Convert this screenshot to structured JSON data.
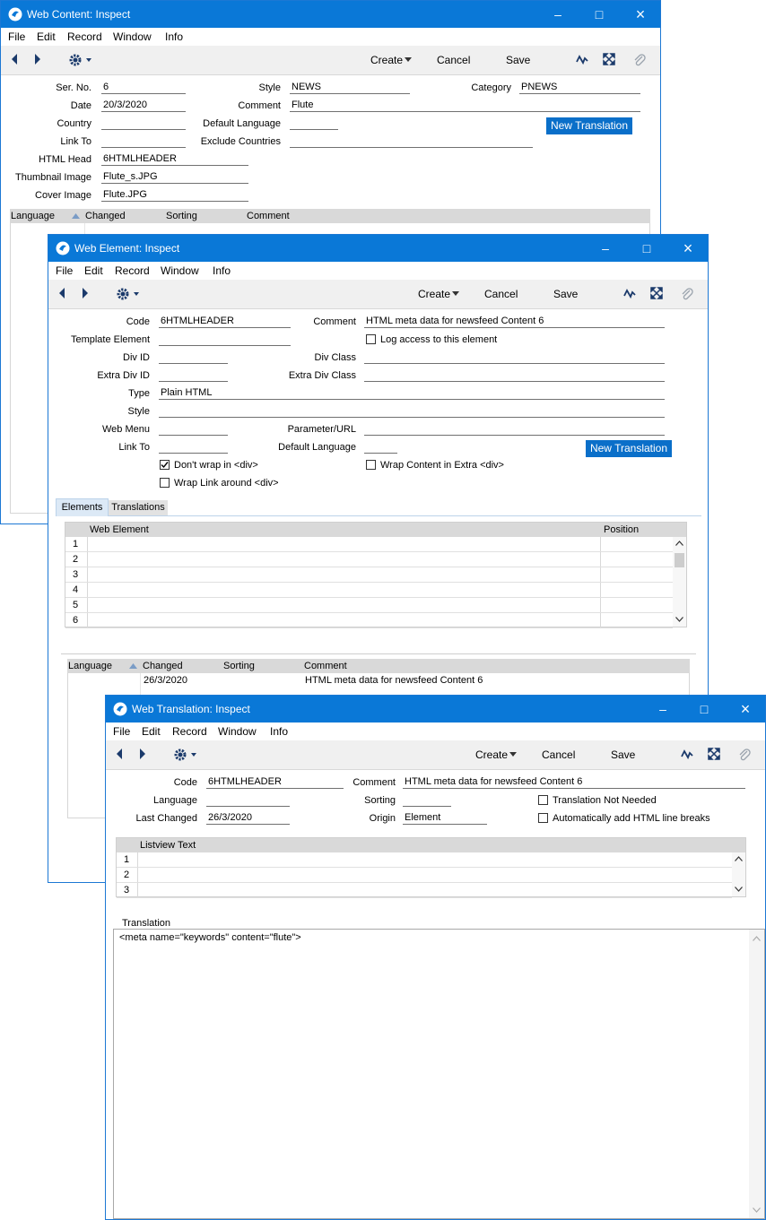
{
  "menu": {
    "file": "File",
    "edit": "Edit",
    "record": "Record",
    "window": "Window",
    "info": "Info"
  },
  "toolbar": {
    "create": "Create",
    "cancel": "Cancel",
    "save": "Save"
  },
  "web_content": {
    "title": "Web Content: Inspect",
    "labels": {
      "ser_no": "Ser. No.",
      "date": "Date",
      "country": "Country",
      "link_to": "Link To",
      "html_head": "HTML Head",
      "thumbnail": "Thumbnail Image",
      "cover": "Cover Image",
      "style": "Style",
      "comment": "Comment",
      "default_language": "Default Language",
      "exclude_countries": "Exclude Countries",
      "category": "Category"
    },
    "values": {
      "ser_no": "6",
      "date": "20/3/2020",
      "country": "",
      "link_to": "",
      "html_head": "6HTMLHEADER",
      "thumbnail": "Flute_s.JPG",
      "cover": "Flute.JPG",
      "style": "NEWS",
      "comment": "Flute",
      "default_language": "",
      "exclude_countries": "",
      "category": "PNEWS"
    },
    "new_translation": "New Translation",
    "list_headers": {
      "language": "Language",
      "changed": "Changed",
      "sorting": "Sorting",
      "comment": "Comment"
    }
  },
  "web_element": {
    "title": "Web Element: Inspect",
    "labels": {
      "code": "Code",
      "template_element": "Template Element",
      "div_id": "Div ID",
      "extra_div_id": "Extra Div ID",
      "type": "Type",
      "style": "Style",
      "web_menu": "Web Menu",
      "link_to": "Link To",
      "comment": "Comment",
      "div_class": "Div Class",
      "extra_div_class": "Extra Div Class",
      "parameter_url": "Parameter/URL",
      "default_language": "Default Language"
    },
    "values": {
      "code": "6HTMLHEADER",
      "template_element": "",
      "div_id": "",
      "extra_div_id": "",
      "type": "Plain HTML",
      "style": "",
      "web_menu": "",
      "link_to": "",
      "comment": "HTML meta data for newsfeed Content 6",
      "div_class": "",
      "extra_div_class": "",
      "parameter_url": "",
      "default_language": ""
    },
    "checkboxes": {
      "log_access": "Log access to this element",
      "dont_wrap": "Don't wrap in <div>",
      "wrap_link": "Wrap Link around <div>",
      "wrap_content": "Wrap Content in Extra <div>"
    },
    "check_states": {
      "log_access": false,
      "dont_wrap": true,
      "wrap_link": false,
      "wrap_content": false
    },
    "new_translation": "New Translation",
    "tabs": {
      "elements": "Elements",
      "translations": "Translations"
    },
    "matrix_headers": {
      "web_element": "Web Element",
      "position": "Position"
    },
    "row_numbers": [
      "1",
      "2",
      "3",
      "4",
      "5",
      "6"
    ],
    "list_headers": {
      "language": "Language",
      "changed": "Changed",
      "sorting": "Sorting",
      "comment": "Comment"
    },
    "list_row": {
      "language": "",
      "changed": "26/3/2020",
      "sorting": "",
      "comment": "HTML meta data for newsfeed Content 6"
    }
  },
  "web_translation": {
    "title": "Web Translation: Inspect",
    "labels": {
      "code": "Code",
      "language": "Language",
      "last_changed": "Last Changed",
      "comment": "Comment",
      "sorting": "Sorting",
      "origin": "Origin"
    },
    "values": {
      "code": "6HTMLHEADER",
      "language": "",
      "last_changed": "26/3/2020",
      "comment": "HTML meta data for newsfeed Content 6",
      "sorting": "",
      "origin": "Element"
    },
    "checkboxes": {
      "not_needed": "Translation Not Needed",
      "auto_breaks": "Automatically add HTML line breaks"
    },
    "check_states": {
      "not_needed": false,
      "auto_breaks": false
    },
    "listview_header": "Listview Text",
    "row_numbers": [
      "1",
      "2",
      "3"
    ],
    "translation_label": "Translation",
    "translation_text": "<meta name=\"keywords\" content=\"flute\">"
  },
  "icons": [
    "app-logo-icon",
    "minimize-icon",
    "maximize-icon",
    "close-icon",
    "arrow-left-icon",
    "arrow-right-icon",
    "gear-icon",
    "activity-icon",
    "expand-icon",
    "paperclip-icon",
    "sort-ascending-icon"
  ],
  "colors": {
    "titlebar": "#0a78d7",
    "button": "#0a6fc9",
    "list_header": "#d9d9d9"
  }
}
